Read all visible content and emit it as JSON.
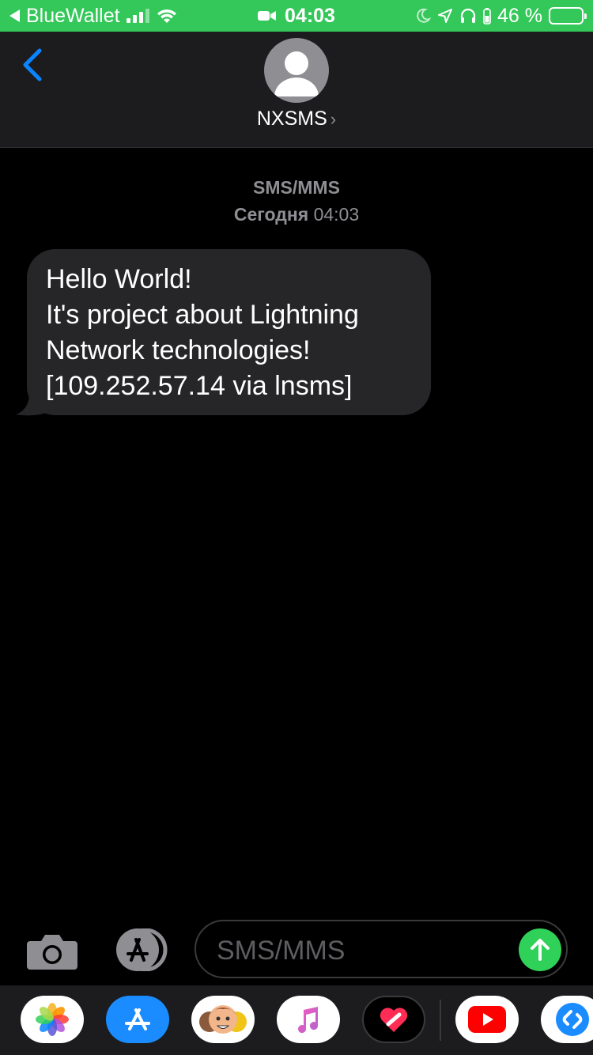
{
  "status_bar": {
    "back_app": "BlueWallet",
    "time": "04:03",
    "battery": "46 %",
    "battery_level": 0.46,
    "icons": [
      "back-arrow-icon",
      "signal-icon",
      "wifi-icon",
      "video-icon",
      "moon-icon",
      "location-icon",
      "headphones-icon",
      "battery-icon"
    ],
    "accent_color": "#34c759"
  },
  "header": {
    "contact_name": "NXSMS",
    "chevron": "›"
  },
  "conversation": {
    "service_label": "SMS/MMS",
    "date_label": "Сегодня",
    "time_label": "04:03",
    "messages": [
      {
        "direction": "incoming",
        "lines": [
          "Hello World!",
          "It's project about Lightning",
          "Network technologies!",
          "[109.252.57.14 via lnsms]"
        ]
      }
    ]
  },
  "input": {
    "placeholder": "SMS/MMS",
    "send_color": "#30d158"
  },
  "app_drawer": {
    "apps": [
      "photos-icon",
      "app-store-icon",
      "memoji-icon",
      "music-icon",
      "digital-touch-icon",
      "youtube-icon",
      "shazam-icon"
    ]
  }
}
